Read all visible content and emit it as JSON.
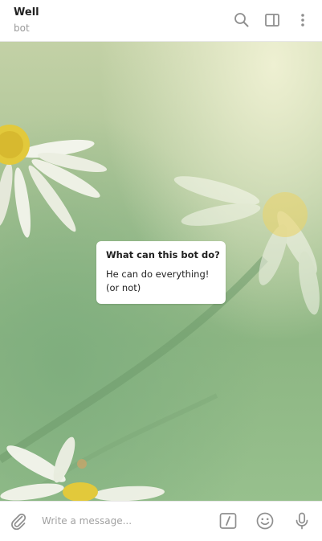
{
  "header": {
    "title": "Well",
    "subtitle": "bot",
    "icons": [
      "search-icon",
      "sidebar-toggle-icon",
      "more-vertical-icon"
    ]
  },
  "bot_info": {
    "title": "What can this bot do?",
    "lines": [
      "He can do everything!",
      "(or not)"
    ]
  },
  "composer": {
    "placeholder": "Write a message...",
    "icons": [
      "paperclip-icon",
      "bot-commands-icon",
      "emoji-icon",
      "microphone-icon"
    ]
  },
  "colors": {
    "icon_gray": "#8f8f8f",
    "wallpaper_green": "#9fc08f"
  }
}
